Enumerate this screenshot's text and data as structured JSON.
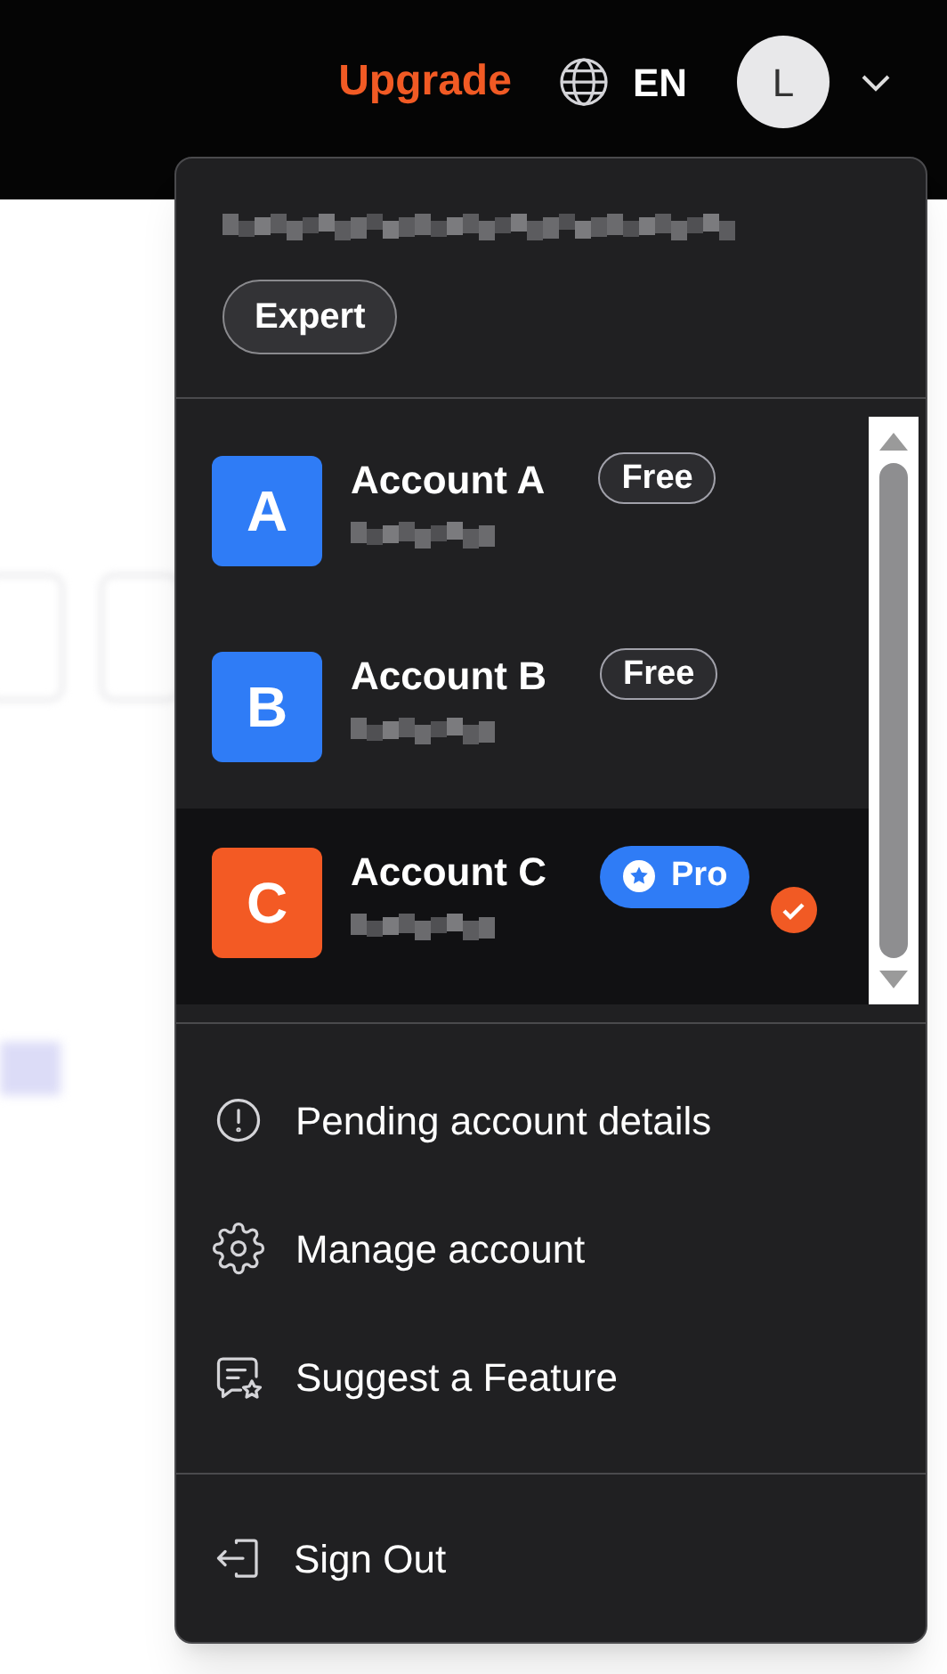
{
  "header": {
    "upgrade": "Upgrade",
    "language": "EN",
    "avatar_initial": "L"
  },
  "menu": {
    "badge": "Expert",
    "accounts": [
      {
        "initial": "A",
        "name": "Account A",
        "plan": "Free",
        "kind": "free",
        "color": "#2f7cf6",
        "selected": false
      },
      {
        "initial": "B",
        "name": "Account B",
        "plan": "Free",
        "kind": "free",
        "color": "#2f7cf6",
        "selected": false
      },
      {
        "initial": "C",
        "name": "Account C",
        "plan": "Pro",
        "kind": "pro",
        "color": "#f35a24",
        "selected": true
      }
    ],
    "items": [
      {
        "kind": "alert",
        "label": "Pending account details"
      },
      {
        "kind": "gear",
        "label": "Manage account"
      },
      {
        "kind": "suggest",
        "label": "Suggest a Feature"
      }
    ],
    "sign_out": "Sign Out"
  }
}
